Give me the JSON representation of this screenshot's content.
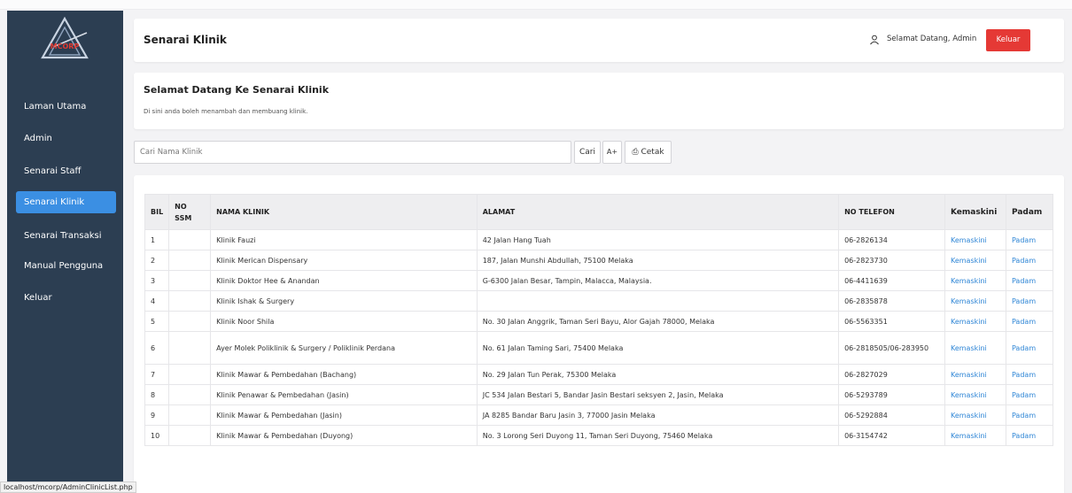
{
  "sidebar": {
    "logo_text": "MCORP",
    "items": [
      {
        "label": "Laman Utama",
        "active": false
      },
      {
        "label": "Admin",
        "active": false
      },
      {
        "label": "Senarai Staff",
        "active": false
      },
      {
        "label": "Senarai Klinik",
        "active": true
      },
      {
        "label": "Senarai Transaksi",
        "active": false
      },
      {
        "label": "Manual Pengguna",
        "active": false
      },
      {
        "label": "Keluar",
        "active": false
      }
    ]
  },
  "header": {
    "title": "Senarai Klinik",
    "welcome": "Selamat Datang, Admin",
    "logout_label": "Keluar"
  },
  "intro": {
    "title": "Selamat Datang Ke Senarai Klinik",
    "description": "Di sini anda boleh menambah dan membuang klinik."
  },
  "search": {
    "placeholder": "Cari Nama Klinik",
    "search_label": "Cari",
    "add_label": "A+",
    "print_label": "⎙ Cetak"
  },
  "table": {
    "headers": {
      "bil": "BIL",
      "ssm": "NO SSM",
      "nama": "NAMA KLINIK",
      "alamat": "ALAMAT",
      "telefon": "NO TELEFON",
      "kemaskini": "Kemaskini",
      "padam": "Padam"
    },
    "rows": [
      {
        "bil": "1",
        "ssm": "",
        "nama": "Klinik Fauzi",
        "alamat": "42 Jalan Hang Tuah",
        "telefon": "06-2826134",
        "kemaskini": "Kemaskini",
        "padam": "Padam"
      },
      {
        "bil": "2",
        "ssm": "",
        "nama": "Klinik Merican Dispensary",
        "alamat": "187, Jalan Munshi Abdullah, 75100 Melaka",
        "telefon": "06-2823730",
        "kemaskini": "Kemaskini",
        "padam": "Padam"
      },
      {
        "bil": "3",
        "ssm": "",
        "nama": "Klinik Doktor Hee & Anandan",
        "alamat": "G-6300 Jalan Besar, Tampin, Malacca, Malaysia.",
        "telefon": "06-4411639",
        "kemaskini": "Kemaskini",
        "padam": "Padam"
      },
      {
        "bil": "4",
        "ssm": "",
        "nama": "Klinik Ishak & Surgery",
        "alamat": "",
        "telefon": "06-2835878",
        "kemaskini": "Kemaskini",
        "padam": "Padam"
      },
      {
        "bil": "5",
        "ssm": "",
        "nama": "Klinik Noor Shila",
        "alamat": "No. 30 Jalan Anggrik, Taman Seri Bayu, Alor Gajah 78000, Melaka",
        "telefon": "06-5563351",
        "kemaskini": "Kemaskini",
        "padam": "Padam"
      },
      {
        "bil": "6",
        "ssm": "",
        "nama": "Ayer Molek Poliklinik & Surgery / Poliklinik Perdana",
        "alamat": "No. 61 Jalan Taming Sari, 75400 Melaka",
        "telefon": "06-2818505/06-283950",
        "kemaskini": "Kemaskini",
        "padam": "Padam"
      },
      {
        "bil": "7",
        "ssm": "",
        "nama": "Klinik Mawar & Pembedahan (Bachang)",
        "alamat": "No. 29 Jalan Tun Perak, 75300 Melaka",
        "telefon": "06-2827029",
        "kemaskini": "Kemaskini",
        "padam": "Padam"
      },
      {
        "bil": "8",
        "ssm": "",
        "nama": "Klinik Penawar & Pembedahan (Jasin)",
        "alamat": "JC 534 Jalan Bestari 5, Bandar Jasin Bestari seksyen 2, Jasin, Melaka",
        "telefon": "06-5293789",
        "kemaskini": "Kemaskini",
        "padam": "Padam"
      },
      {
        "bil": "9",
        "ssm": "",
        "nama": "Klinik Mawar & Pembedahan (Jasin)",
        "alamat": "JA 8285 Bandar Baru Jasin 3, 77000 Jasin Melaka",
        "telefon": "06-5292884",
        "kemaskini": "Kemaskini",
        "padam": "Padam"
      },
      {
        "bil": "10",
        "ssm": "",
        "nama": "Klinik Mawar & Pembedahan (Duyong)",
        "alamat": "No. 3 Lorong Seri Duyong 11, Taman Seri Duyong, 75460 Melaka",
        "telefon": "06-3154742",
        "kemaskini": "Kemaskini",
        "padam": "Padam"
      }
    ]
  },
  "status_bar": {
    "url": "localhost/mcorp/AdminClinicList.php"
  }
}
